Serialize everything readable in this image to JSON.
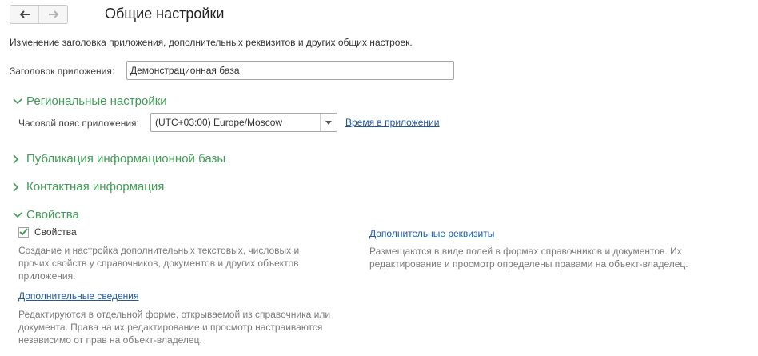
{
  "page": {
    "title": "Общие настройки",
    "description": "Изменение заголовка приложения, дополнительных реквизитов и других общих настроек."
  },
  "nav": {
    "back_icon": "arrow-left-icon",
    "forward_icon": "arrow-right-icon"
  },
  "app_title": {
    "label": "Заголовок приложения:",
    "value": "Демонстрационная база"
  },
  "regional": {
    "heading": "Региональные настройки",
    "timezone_label": "Часовой пояс приложения:",
    "timezone_value": "(UTC+03:00) Europe/Moscow",
    "time_link": "Время в приложении"
  },
  "sections": {
    "publication": "Публикация информационной базы",
    "contact": "Контактная информация",
    "properties": "Свойства"
  },
  "properties": {
    "checkbox_label": "Свойства",
    "checkbox_checked": true,
    "checkbox_hint": [
      "Создание и настройка дополнительных текстовых, числовых и",
      "прочих свойств у справочников, документов и других объектов",
      "приложения."
    ],
    "extra_details_link": "Дополнительные реквизиты",
    "extra_details_hint": [
      "Размещаются в виде полей в формах справочников и документов. Их",
      "редактирование и просмотр определены правами на объект-владелец."
    ],
    "extra_info_link": "Дополнительные сведения",
    "extra_info_hint": [
      "Редактируются в отдельной форме, открываемой из справочника или",
      "документа. Права на их редактирование и просмотр настраиваются",
      "независимо от прав на объект-владелец."
    ]
  },
  "colors": {
    "section_green": "#3f9e55",
    "link_blue": "#215a9f",
    "hint_gray": "#7b7b7b"
  }
}
